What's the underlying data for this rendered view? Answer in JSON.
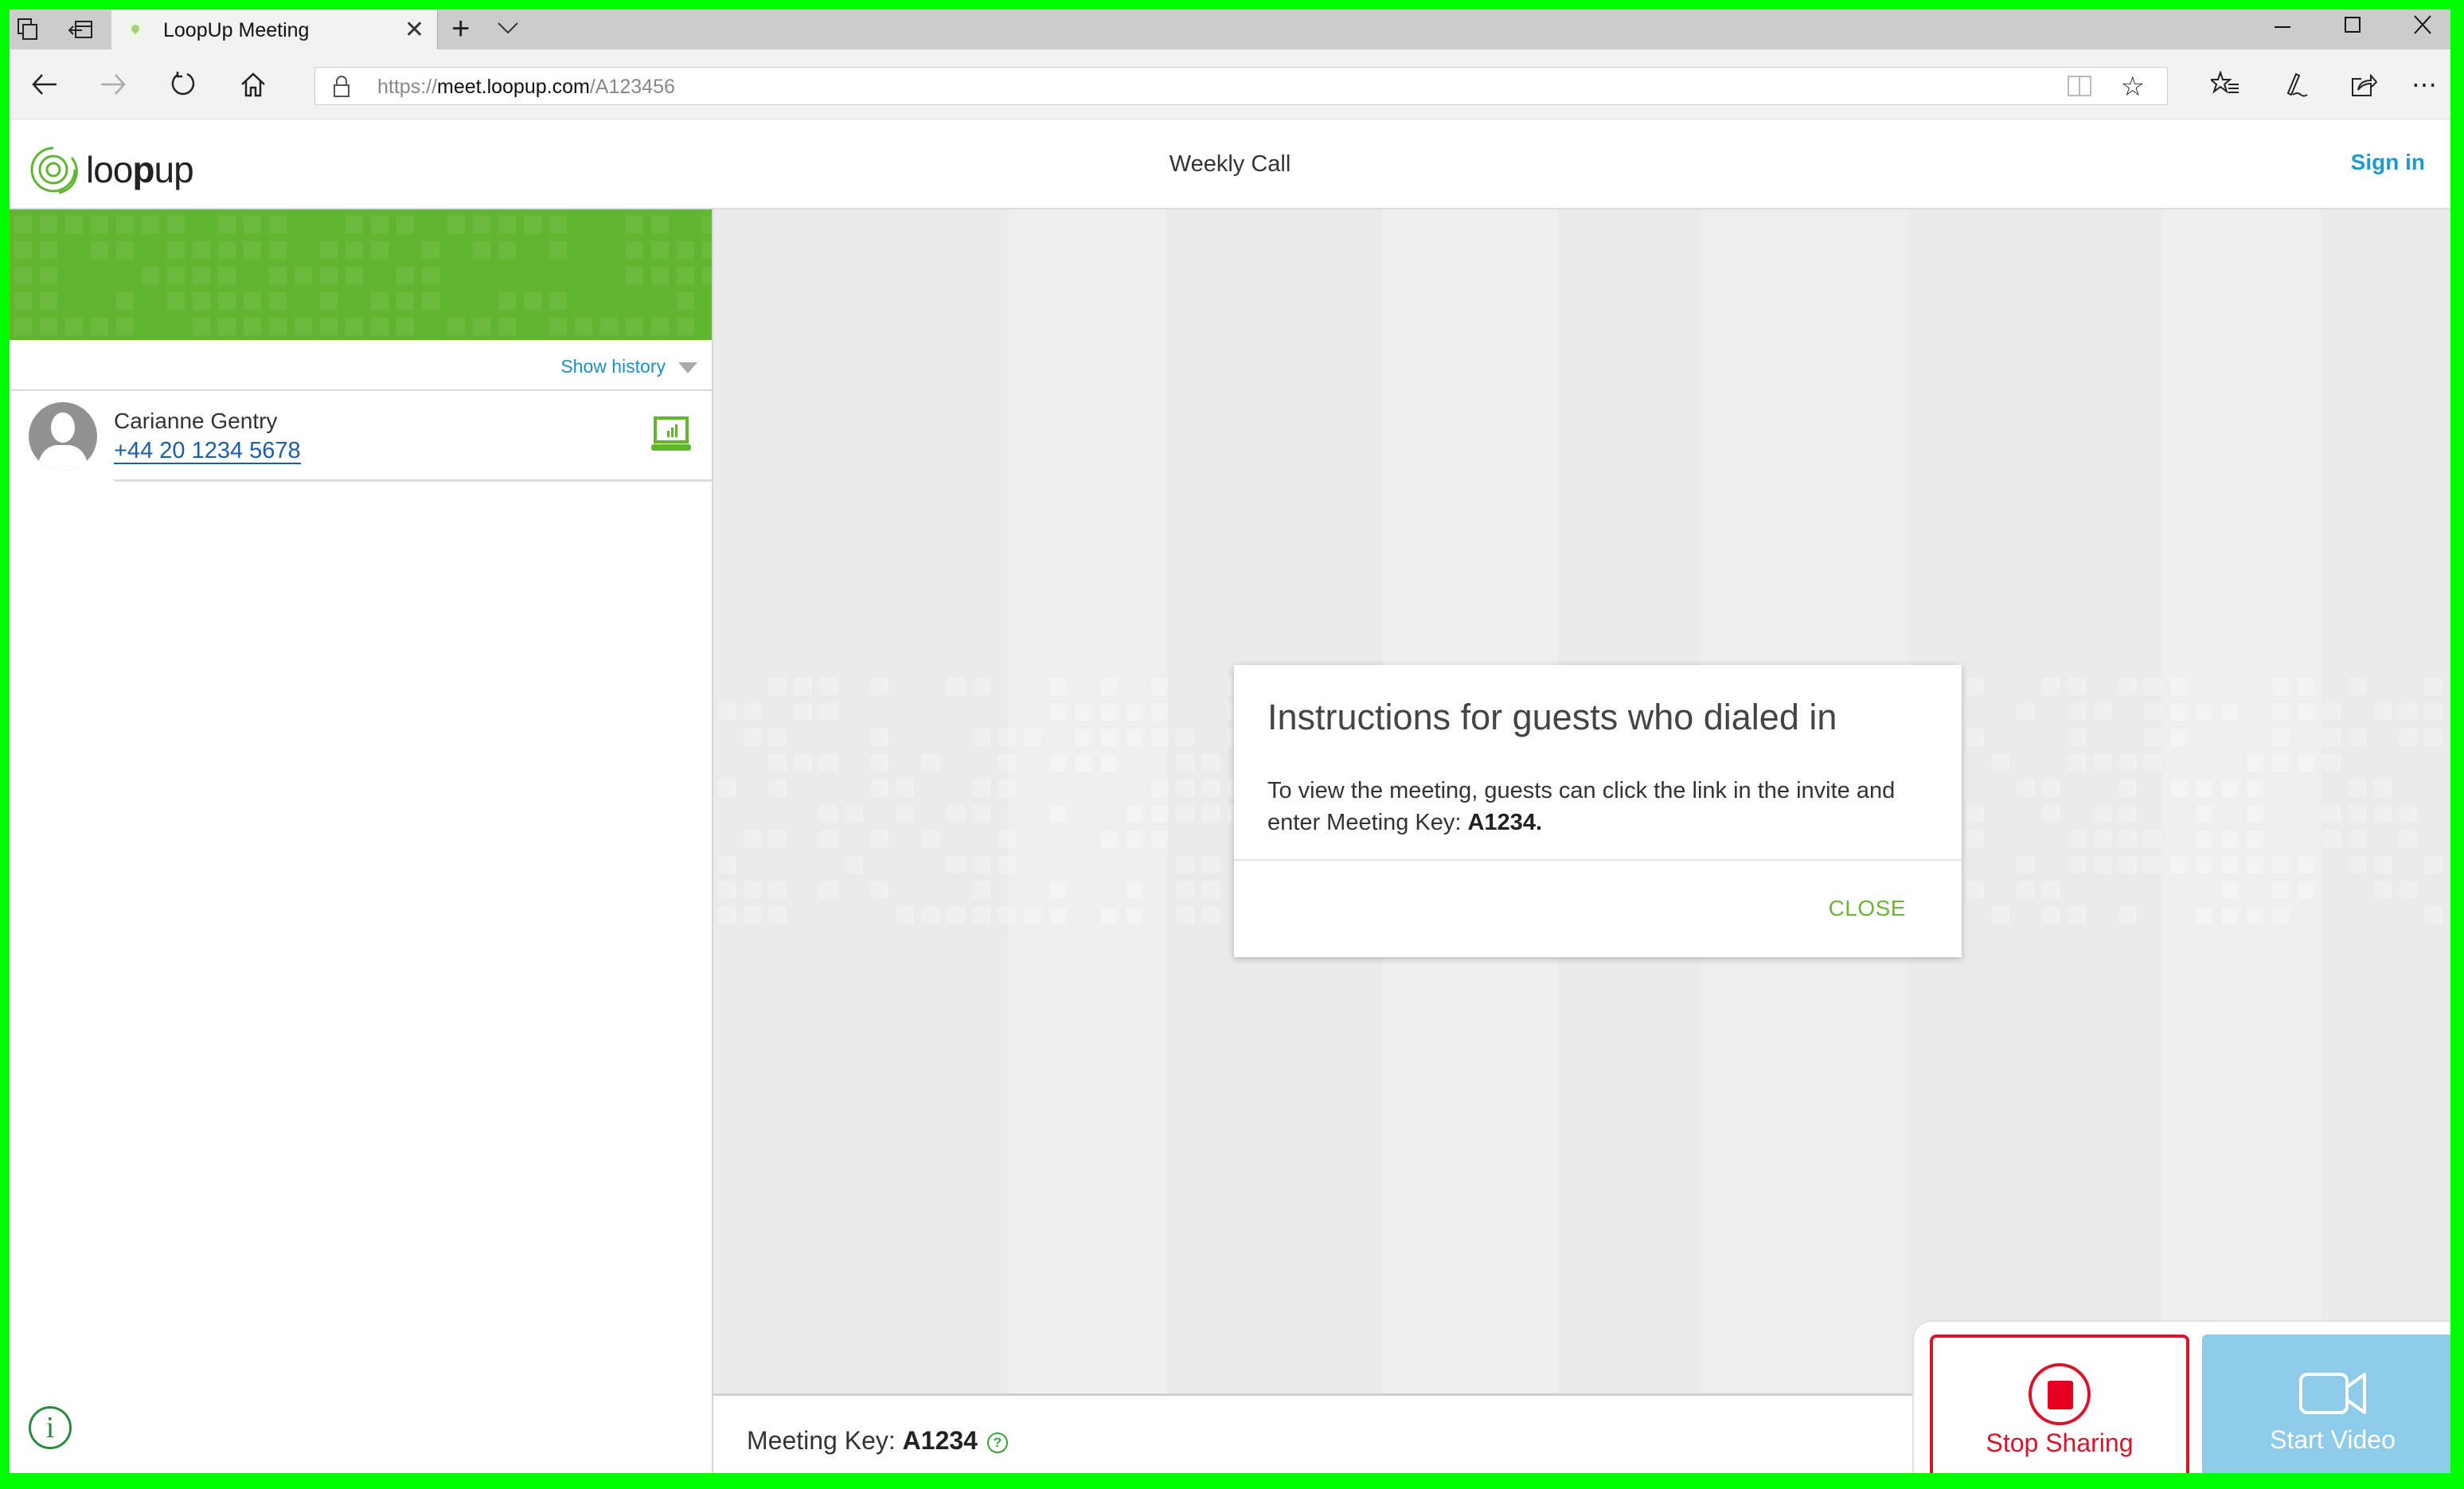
{
  "browser": {
    "tab_title": "LoopUp Meeting",
    "url_scheme": "https://",
    "url_host": "meet.loopup.com",
    "url_path": "/A123456",
    "icons": {
      "tab_actions": "tabs-aside-icon",
      "tab_restore": "set-tabs-aside-icon",
      "new_tab": "plus-icon",
      "tab_list": "chevron-down-icon",
      "back": "arrow-left-icon",
      "forward": "arrow-right-icon",
      "refresh": "refresh-icon",
      "home": "home-icon",
      "lock": "lock-icon",
      "reading_view": "book-icon",
      "favorite": "star-icon",
      "favorites_list": "favorites-icon",
      "notes": "pen-icon",
      "share": "share-icon",
      "more": "ellipsis-icon",
      "minimize": "minimize-icon",
      "maximize": "maximize-icon",
      "close": "close-icon"
    },
    "glyphs": {
      "tab_close": "✕",
      "new_tab": "+",
      "tab_list": "⌵",
      "back": "←",
      "forward": "→",
      "refresh": "↻",
      "favorite": "☆",
      "more": "⋯",
      "minimize": "—",
      "maximize": "☐",
      "close": "✕"
    }
  },
  "header": {
    "logo_prefix": "loo",
    "logo_bold": "p",
    "logo_suffix": "up",
    "meeting_title": "Weekly Call",
    "sign_in": "Sign in"
  },
  "sidebar": {
    "show_history": "Show history",
    "participants": [
      {
        "name": "Carianne Gentry",
        "phone": "+44 20 1234 5678",
        "device": "laptop-sharing-icon"
      }
    ],
    "info_glyph": "i"
  },
  "modal": {
    "title": "Instructions for guests who dialed in",
    "body_prefix": "To view the meeting, guests can click the link in the invite and enter Meeting Key: ",
    "body_key": "A1234.",
    "close_label": "CLOSE"
  },
  "footer": {
    "meeting_key_label": "Meeting Key: ",
    "meeting_key_value": "A1234",
    "help_glyph": "?"
  },
  "controls": {
    "stop_sharing": "Stop Sharing",
    "start_video": "Start Video"
  },
  "colors": {
    "brand_green": "#62b531",
    "link_blue": "#1e9bc9",
    "stop_red": "#d9142b",
    "video_blue": "#8dcbe8"
  }
}
